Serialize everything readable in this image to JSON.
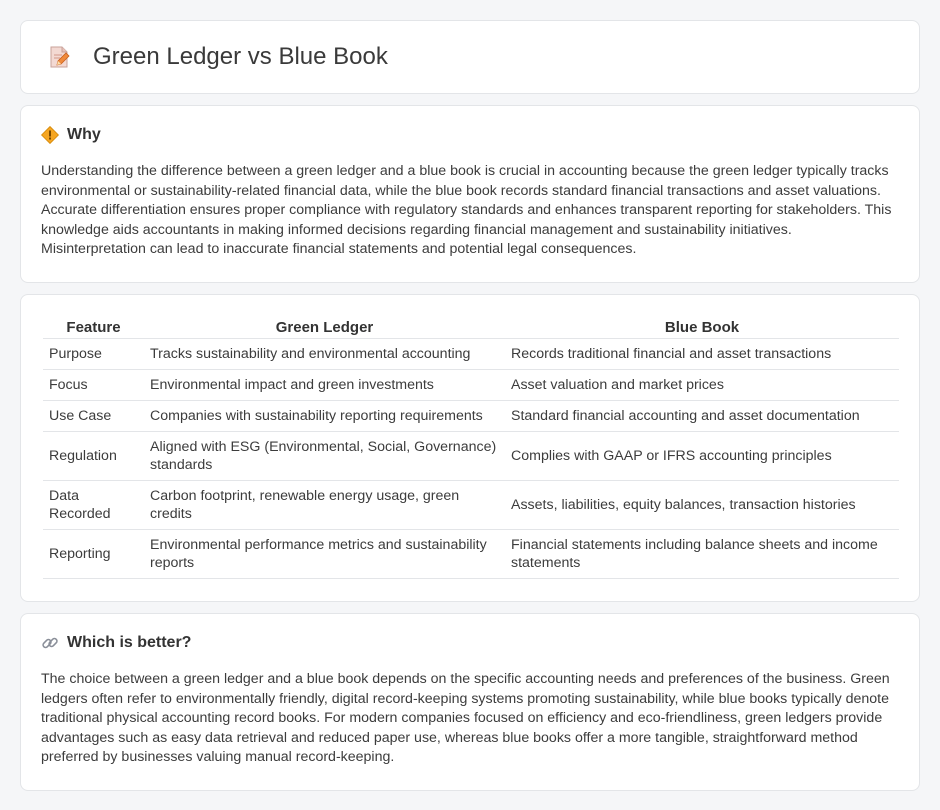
{
  "page": {
    "title": "Green Ledger vs Blue Book"
  },
  "why": {
    "heading": "Why",
    "text": "Understanding the difference between a green ledger and a blue book is crucial in accounting because the green ledger typically tracks environmental or sustainability-related financial data, while the blue book records standard financial transactions and asset valuations. Accurate differentiation ensures proper compliance with regulatory standards and enhances transparent reporting for stakeholders. This knowledge aids accountants in making informed decisions regarding financial management and sustainability initiatives. Misinterpretation can lead to inaccurate financial statements and potential legal consequences."
  },
  "table": {
    "headers": [
      "Feature",
      "Green Ledger",
      "Blue Book"
    ],
    "rows": [
      [
        "Purpose",
        "Tracks sustainability and environmental accounting",
        "Records traditional financial and asset transactions"
      ],
      [
        "Focus",
        "Environmental impact and green investments",
        "Asset valuation and market prices"
      ],
      [
        "Use Case",
        "Companies with sustainability reporting requirements",
        "Standard financial accounting and asset documentation"
      ],
      [
        "Regulation",
        "Aligned with ESG (Environmental, Social, Governance) standards",
        "Complies with GAAP or IFRS accounting principles"
      ],
      [
        "Data Recorded",
        "Carbon footprint, renewable energy usage, green credits",
        "Assets, liabilities, equity balances, transaction histories"
      ],
      [
        "Reporting",
        "Environmental performance metrics and sustainability reports",
        "Financial statements including balance sheets and income statements"
      ]
    ]
  },
  "better": {
    "heading": "Which is better?",
    "text": "The choice between a green ledger and a blue book depends on the specific accounting needs and preferences of the business. Green ledgers often refer to environmentally friendly, digital record-keeping systems promoting sustainability, while blue books typically denote traditional physical accounting record books. For modern companies focused on efficiency and eco-friendliness, green ledgers provide advantages such as easy data retrieval and reduced paper use, whereas blue books offer a more tangible, straightforward method preferred by businesses valuing manual record-keeping."
  },
  "icons": {
    "title": "document-pencil-icon",
    "why": "diamond-sign-icon",
    "better": "link-icon"
  }
}
